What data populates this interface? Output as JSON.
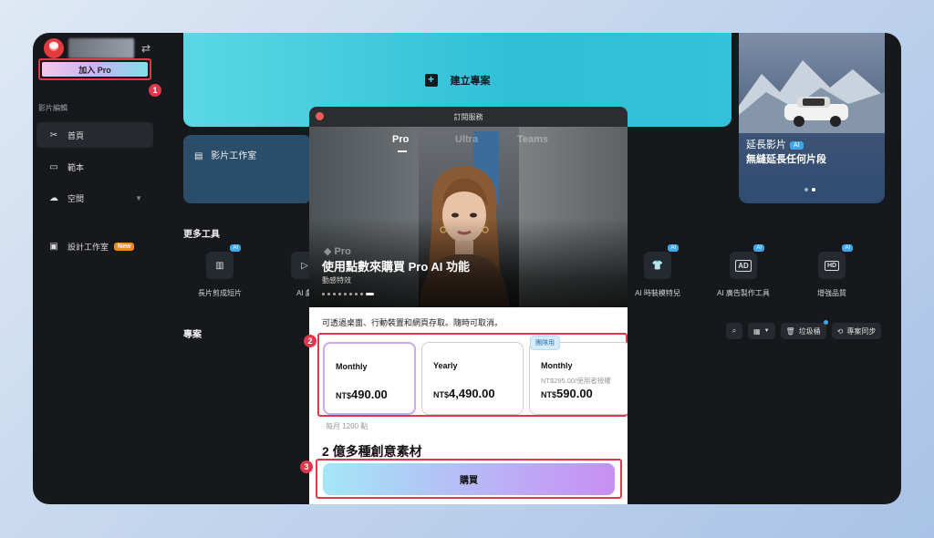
{
  "sidebar": {
    "join_pro_label": "加入 Pro",
    "section_label": "影片編輯",
    "items": [
      {
        "label": "首頁",
        "icon": "scissors-icon"
      },
      {
        "label": "範本",
        "icon": "template-icon"
      },
      {
        "label": "空間",
        "icon": "cloud-icon"
      },
      {
        "label": "設計工作室",
        "icon": "image-icon",
        "badge": "New"
      }
    ]
  },
  "main": {
    "create_label": "建立專案",
    "studio_label": "影片工作室",
    "extend": {
      "title": "延長影片",
      "tag": "AI",
      "subtitle": "無縫延長任何片段"
    },
    "more_tools_label": "更多工具",
    "tools": [
      {
        "label": "長片剪成短片",
        "tag": "AI",
        "icon": "film-icon"
      },
      {
        "label": "AI 劇",
        "tag": "AI",
        "icon": "play-icon"
      },
      {
        "label": "AI 時裝模特兒",
        "tag": "AI",
        "icon": "shirt-icon"
      },
      {
        "label": "AI 廣告製作工具",
        "tag": "AI",
        "icon": "ad-icon",
        "glyph": "AD"
      },
      {
        "label": "增強品質",
        "tag": "AI",
        "icon": "hd-icon",
        "glyph": "HD"
      }
    ],
    "projects_label": "專案",
    "trash_label": "垃圾桶",
    "sync_label": "專案同步"
  },
  "modal": {
    "title": "訂閱服務",
    "tabs": [
      "Pro",
      "Ultra",
      "Teams"
    ],
    "pro_logo": "Pro",
    "hero_title": "使用點數來購買 Pro AI 功能",
    "hero_sub": "動感特效",
    "access_text": "可透過桌面、行動裝置和網頁存取。隨時可取消。",
    "plans": [
      {
        "name": "Monthly",
        "currency": "NT$",
        "price": "490.00",
        "note": ""
      },
      {
        "name": "Yearly",
        "currency": "NT$",
        "price": "4,490.00",
        "note": ""
      },
      {
        "name": "Monthly",
        "currency": "NT$",
        "price": "590.00",
        "note": "NT$295.00/使用者授權",
        "tag": "團隊用"
      }
    ],
    "points_text": "每月 1200 點",
    "materials_text": "2 億多種創意素材",
    "buy_label": "購買"
  },
  "annotations": [
    "1",
    "2",
    "3"
  ],
  "colors": {
    "accent_red": "#e0384a",
    "cyan": "#2fc0d6",
    "ai_blue": "#3fa7ee"
  }
}
